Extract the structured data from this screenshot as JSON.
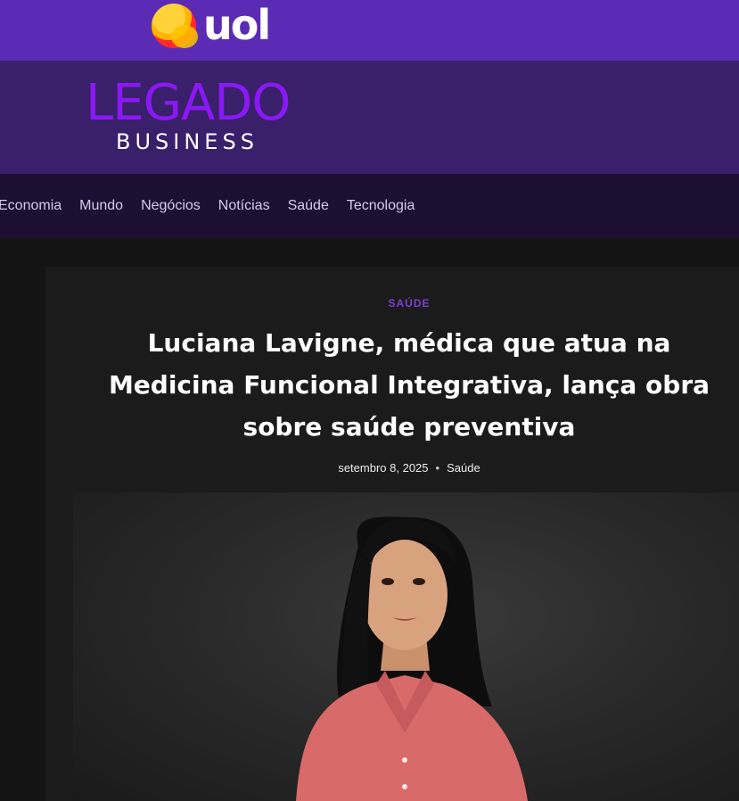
{
  "header": {
    "portal_logo": "uol",
    "site_logo_main": "LEGADO",
    "site_logo_sub": "BUSINESS"
  },
  "nav": {
    "items": [
      "Economia",
      "Mundo",
      "Negócios",
      "Notícias",
      "Saúde",
      "Tecnologia"
    ]
  },
  "article": {
    "category": "SAÚDE",
    "title": "Luciana Lavigne, médica que atua na Medicina Funcional Integrativa, lança obra sobre saúde preventiva",
    "date": "setembro 8, 2025",
    "meta_category": "Saúde",
    "image": "portrait of a woman with long dark hair wearing a coral shirt"
  },
  "colors": {
    "topbar": "#5b2bb5",
    "brandbar": "#3a1f6b",
    "navbar": "#1c0f32",
    "accent": "#8a18f5",
    "page_bg": "#141414"
  }
}
